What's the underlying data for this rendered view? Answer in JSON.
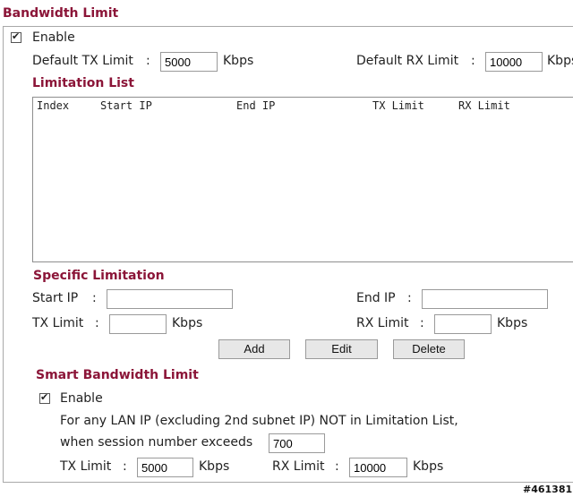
{
  "bandwidth": {
    "title": "Bandwidth Limit",
    "enable_label": "Enable",
    "enable_checked": true,
    "default_tx_label": "Default TX Limit",
    "default_tx_value": "5000",
    "default_tx_unit": "Kbps",
    "default_rx_label": "Default RX Limit",
    "default_rx_value": "10000",
    "default_rx_unit": "Kbps",
    "colon": ":"
  },
  "limitation_list": {
    "title": "Limitation List",
    "columns": [
      "Index",
      "Start IP",
      "End IP",
      "TX Limit",
      "RX Limit"
    ],
    "rows": []
  },
  "specific": {
    "title": "Specific Limitation",
    "start_ip_label": "Start IP",
    "start_ip_value": "",
    "end_ip_label": "End IP",
    "end_ip_value": "",
    "tx_label": "TX Limit",
    "tx_value": "",
    "tx_unit": "Kbps",
    "rx_label": "RX Limit",
    "rx_value": "",
    "rx_unit": "Kbps",
    "colon": ":",
    "buttons": {
      "add": "Add",
      "edit": "Edit",
      "delete": "Delete"
    }
  },
  "smart": {
    "title": "Smart Bandwidth Limit",
    "enable_label": "Enable",
    "enable_checked": true,
    "desc_line1": "For any LAN IP (excluding 2nd subnet IP) NOT in Limitation List,",
    "desc_line2": "when session number exceeds",
    "session_value": "700",
    "tx_label": "TX Limit",
    "tx_value": "5000",
    "tx_unit": "Kbps",
    "rx_label": "RX Limit",
    "rx_value": "10000",
    "rx_unit": "Kbps",
    "colon": ":"
  },
  "watermark": "#461381"
}
